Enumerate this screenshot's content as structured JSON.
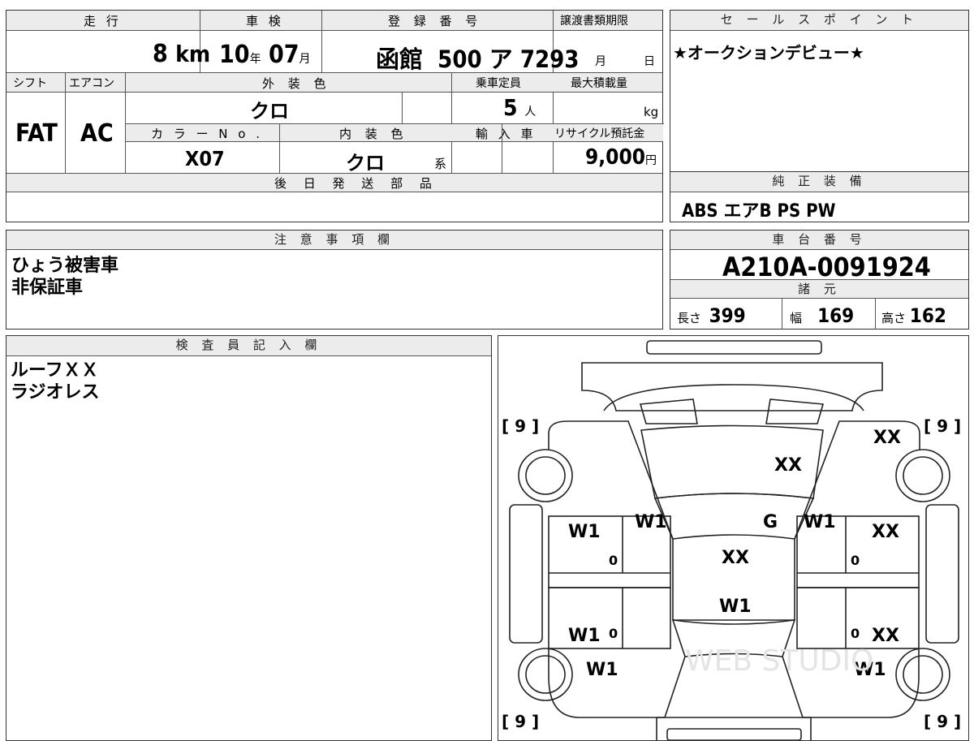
{
  "vehicle_info": {
    "headers": {
      "mileage": "走 行",
      "shaken": "車 検",
      "registration": "登 録 番 号",
      "transfer_deadline": "譲渡書類期限",
      "shift": "シフト",
      "aircon": "エアコン",
      "exterior_color": "外 装 色",
      "capacity": "乗車定員",
      "max_load": "最大積載量",
      "color_no": "カ ラ ー N o .",
      "interior_color": "内 装 色",
      "import": "輸 入 車",
      "recycle_fee": "リサイクル預託金",
      "later_parts": "後 日 発 送 部 品"
    },
    "mileage": {
      "value": "8",
      "unit": "km"
    },
    "shaken": {
      "year": "10",
      "year_unit": "年",
      "month": "07",
      "month_unit": "月"
    },
    "registration": {
      "office": "函館",
      "class": "500",
      "kana": "ア",
      "number": "7293"
    },
    "transfer_deadline": {
      "month_unit": "月",
      "day_unit": "日"
    },
    "shift": "FAT",
    "aircon": "AC",
    "exterior_color": "クロ",
    "capacity": {
      "value": "5",
      "unit": "人"
    },
    "max_load": {
      "value": "",
      "unit": "kg"
    },
    "color_no": "X07",
    "interior_color": {
      "value": "クロ",
      "suffix": "系"
    },
    "recycle_fee": {
      "value": "9,000",
      "unit": "円"
    },
    "later_parts": ""
  },
  "sales_points": {
    "header": "セ ー ル ス ポ イ ン ト",
    "text": "★オークションデビュー★"
  },
  "genuine_equipment": {
    "header": "純 正 装 備",
    "text": "ABS エアB PS PW"
  },
  "caution": {
    "header": "注 意 事 項 欄",
    "lines": [
      "ひょう被害車",
      "非保証車"
    ]
  },
  "chassis": {
    "header": "車 台 番 号",
    "number": "A210A-0091924"
  },
  "specs": {
    "header": "諸 元",
    "length": {
      "label": "長さ",
      "value": "399"
    },
    "width": {
      "label": "幅",
      "value": "169"
    },
    "height": {
      "label": "高さ",
      "value": "162"
    }
  },
  "inspector": {
    "header": "検 査 員 記 入 欄",
    "lines": [
      "ルーフＸＸ",
      "ラジオレス"
    ]
  },
  "diagram": {
    "tires": {
      "front_left": "9",
      "front_right": "9",
      "rear_left": "9",
      "rear_right": "9"
    },
    "marks": {
      "front_right_fender": "XX",
      "hood": "XX",
      "windshield_left": "W1",
      "windshield_center": "G",
      "windshield_right": "W1",
      "front_left_door_glass": "W1",
      "front_right_door": "XX",
      "roof": "XX",
      "rear_glass": "W1",
      "rear_left_door_glass": "W1",
      "rear_right_door": "XX",
      "rear_left_quarter_glass": "W1",
      "rear_right_quarter_glass": "W1",
      "zero": "0"
    },
    "watermark": "WEB STUDIO"
  }
}
